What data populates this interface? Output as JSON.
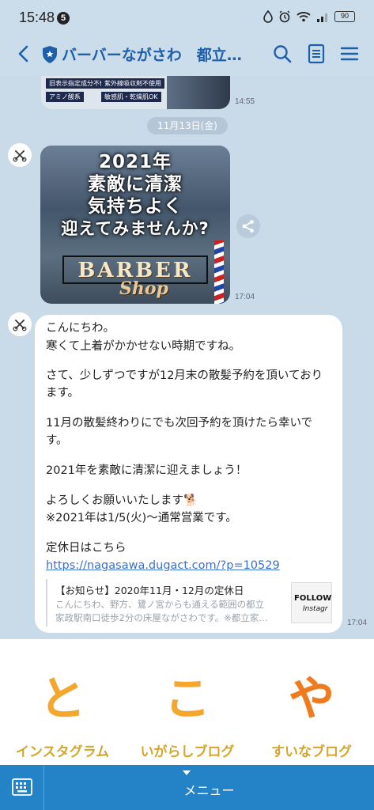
{
  "status_bar": {
    "time": "15:48",
    "notification_count": "5",
    "battery": "90"
  },
  "header": {
    "title": "バーバーながさわ　都立家政…"
  },
  "chat": {
    "prev_image_tags": [
      "旧表示指定成分不使用",
      "紫外線吸収剤不使用",
      "アミノ酸系",
      "敏感肌・乾燥肌OK"
    ],
    "prev_time": "14:55",
    "date_separator": "11月13日(金)",
    "image_message": {
      "lines": [
        "2021年",
        "素敵に清潔",
        "気持ちよく",
        "迎えてみませんか?"
      ],
      "logo_text": "BARBER",
      "logo_script": "Shop",
      "time": "17:04"
    },
    "text_message": {
      "lines": [
        "こんにちわ。",
        "寒くて上着がかかせない時期ですね。",
        "さて、少しずつですが12月末の散髪予約を頂いており",
        "ます。",
        "11月の散髪終わりにでも次回予約を頂けたら幸いで",
        "す。",
        "2021年を素敵に清潔に迎えましょう！",
        "よろしくお願いいたします🐕",
        "※2021年は1/5(火)〜通常営業です。",
        "定休日はこちら"
      ],
      "link": "https://nagasawa.dugact.com/?p=10529",
      "preview_title": "【お知らせ】2020年11月・12月の定休日",
      "preview_desc_1": "こんにちわ、野方、鷺ノ宮からも通える範囲の都立",
      "preview_desc_2": "家政駅南口徒歩2分の床屋ながさわです。※都立家…",
      "preview_thumb_1": "FOLLOW",
      "preview_thumb_2": "Instagr",
      "time": "17:04"
    }
  },
  "rich_menu": {
    "items": [
      {
        "glyph": "と",
        "label": "インスタグラム"
      },
      {
        "glyph": "こ",
        "label": "いがらしブログ"
      },
      {
        "glyph": "や",
        "label": "すいなブログ"
      }
    ]
  },
  "bottom_bar": {
    "menu_label": "メニュー"
  },
  "colors": {
    "accent": "#2483c6",
    "title": "#1d5fa8",
    "chat_bg": "#c9dbe9",
    "rich_menu_text": "#f4a72a"
  }
}
